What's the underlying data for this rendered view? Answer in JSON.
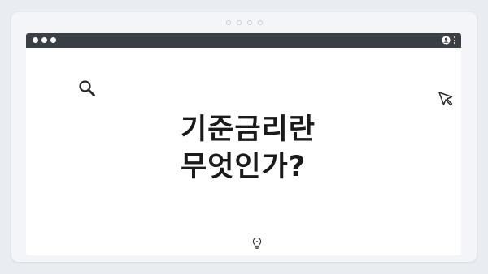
{
  "headline": {
    "line1": "기준금리란",
    "line2": "무엇인가?"
  },
  "icons": {
    "search": "search-icon",
    "cursor": "cursor-icon",
    "bulb": "lightbulb-icon",
    "user": "user-icon",
    "menu": "kebab-menu-icon"
  },
  "colors": {
    "background": "#e9edf2",
    "titlebar": "#3a3e45",
    "content": "#ffffff",
    "text": "#1a1a1a"
  }
}
